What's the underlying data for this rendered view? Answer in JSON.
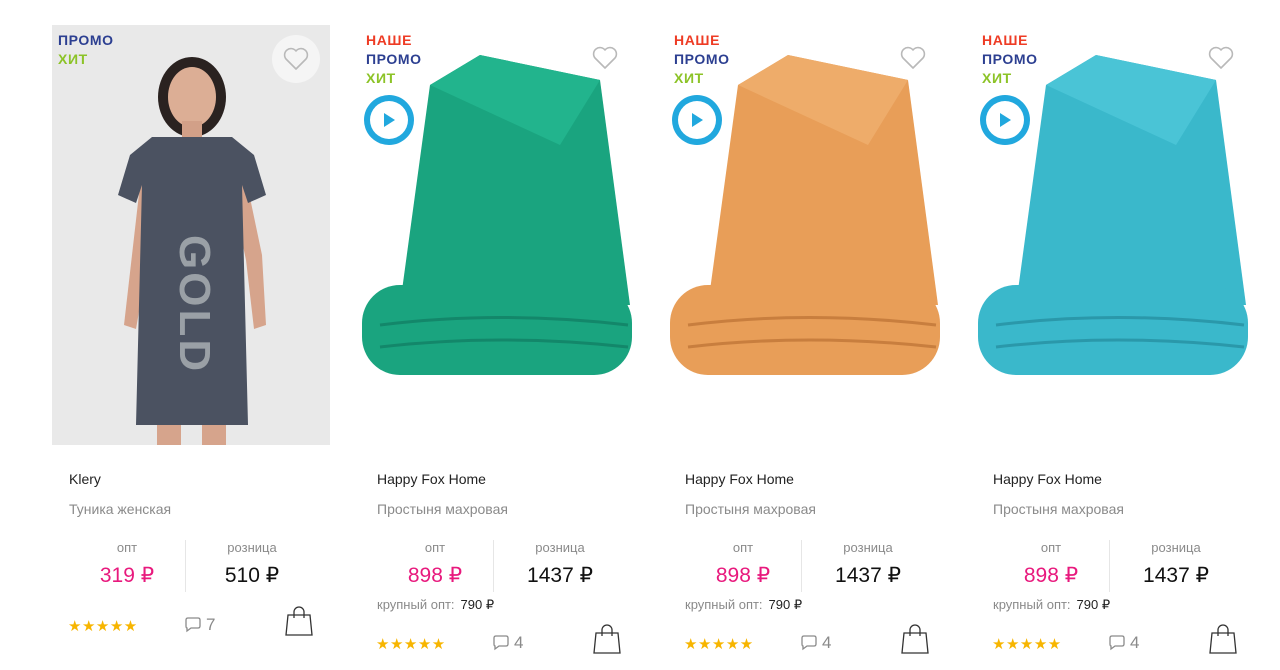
{
  "currency": "₽",
  "products": [
    {
      "badges": [
        {
          "text": "ПРОМО",
          "color": "#2c3f91"
        },
        {
          "text": "ХИТ",
          "color": "#8cc327"
        }
      ],
      "has_video": false,
      "image": "woman in dark gray tunic with GOLD print",
      "brand": "Klery",
      "title": "Туника женская",
      "opt_label": "опт",
      "opt_price": "319 ₽",
      "retail_label": "розница",
      "retail_price": "510 ₽",
      "bulk_label": "",
      "bulk_price": "",
      "rating": 5,
      "reviews": "7"
    },
    {
      "badges": [
        {
          "text": "НАШЕ",
          "color": "#ee3b24"
        },
        {
          "text": "ПРОМО",
          "color": "#2c3f91"
        },
        {
          "text": "ХИТ",
          "color": "#8cc327"
        }
      ],
      "has_video": true,
      "image": "folded green terry sheet",
      "towel_color": "#1aa47f",
      "brand": "Happy Fox Home",
      "title": "Простыня махровая",
      "opt_label": "опт",
      "opt_price": "898 ₽",
      "retail_label": "розница",
      "retail_price": "1437 ₽",
      "bulk_label": "крупный опт:",
      "bulk_price": "790 ₽",
      "rating": 5,
      "reviews": "4"
    },
    {
      "badges": [
        {
          "text": "НАШЕ",
          "color": "#ee3b24"
        },
        {
          "text": "ПРОМО",
          "color": "#2c3f91"
        },
        {
          "text": "ХИТ",
          "color": "#8cc327"
        }
      ],
      "has_video": true,
      "image": "folded orange terry sheet",
      "towel_color": "#e89e58",
      "brand": "Happy Fox Home",
      "title": "Простыня махровая",
      "opt_label": "опт",
      "opt_price": "898 ₽",
      "retail_label": "розница",
      "retail_price": "1437 ₽",
      "bulk_label": "крупный опт:",
      "bulk_price": "790 ₽",
      "rating": 5,
      "reviews": "4"
    },
    {
      "badges": [
        {
          "text": "НАШЕ",
          "color": "#ee3b24"
        },
        {
          "text": "ПРОМО",
          "color": "#2c3f91"
        },
        {
          "text": "ХИТ",
          "color": "#8cc327"
        }
      ],
      "has_video": true,
      "image": "folded light blue terry sheet",
      "towel_color": "#3ab8cb",
      "brand": "Happy Fox Home",
      "title": "Простыня махровая",
      "opt_label": "опт",
      "opt_price": "898 ₽",
      "retail_label": "розница",
      "retail_price": "1437 ₽",
      "bulk_label": "крупный опт:",
      "bulk_price": "790 ₽",
      "rating": 5,
      "reviews": "4"
    }
  ],
  "icons": {
    "favorite": "heart-outline-icon",
    "play": "play-icon",
    "reviews": "speech-bubble-icon",
    "cart": "shopping-bag-icon",
    "rating": "star-icon"
  }
}
